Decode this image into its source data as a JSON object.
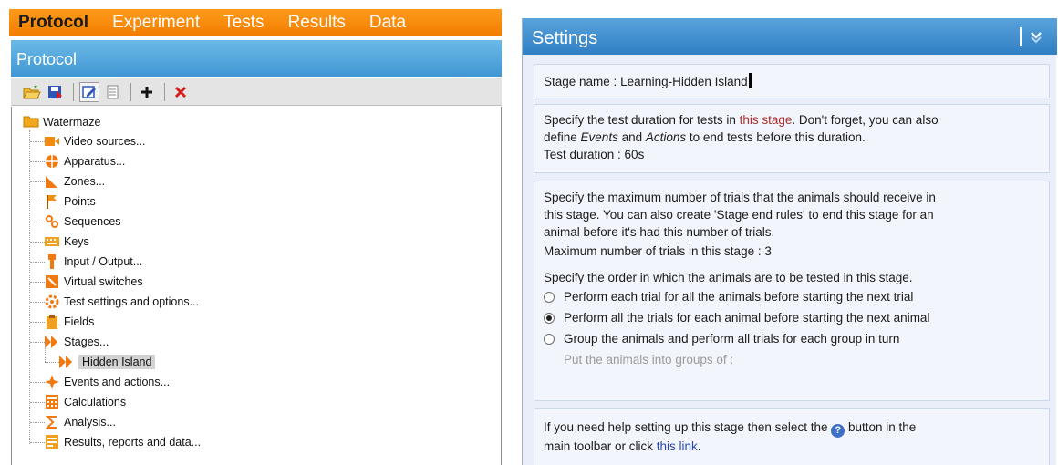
{
  "left_panel": {
    "menu": [
      "Protocol",
      "Experiment",
      "Tests",
      "Results",
      "Data"
    ],
    "section_title": "Protocol",
    "tree": {
      "root": "Watermaze",
      "items": [
        {
          "label": "Video sources...",
          "icon": "video-icon"
        },
        {
          "label": "Apparatus...",
          "icon": "apparatus-icon"
        },
        {
          "label": "Zones...",
          "icon": "zones-icon"
        },
        {
          "label": "Points",
          "icon": "flag-icon"
        },
        {
          "label": "Sequences",
          "icon": "sequences-icon"
        },
        {
          "label": "Keys",
          "icon": "keyboard-icon"
        },
        {
          "label": "Input / Output...",
          "icon": "io-icon"
        },
        {
          "label": "Virtual switches",
          "icon": "switch-icon"
        },
        {
          "label": "Test settings and options...",
          "icon": "gear-icon"
        },
        {
          "label": "Fields",
          "icon": "clipboard-icon"
        },
        {
          "label": "Stages...",
          "icon": "stages-icon"
        },
        {
          "label": "Hidden Island",
          "icon": "stages-icon",
          "child": true,
          "selected": true
        },
        {
          "label": "Events and actions...",
          "icon": "event-icon"
        },
        {
          "label": "Calculations",
          "icon": "calculator-icon"
        },
        {
          "label": "Analysis...",
          "icon": "sigma-icon"
        },
        {
          "label": "Results, reports and data...",
          "icon": "report-icon"
        }
      ]
    }
  },
  "settings": {
    "title": "Settings",
    "stage_name_label": "Stage name  :  ",
    "stage_name_value": "Learning-Hidden Island",
    "duration": {
      "text_a": "Specify the test duration for tests in ",
      "link": "this stage",
      "text_b": ". Don't forget, you can also",
      "text_c": "define ",
      "events": "Events",
      "and": " and ",
      "actions": "Actions",
      "text_d": " to end tests before this duration.",
      "label": "Test duration  :  60s"
    },
    "trials": {
      "line1": "Specify the maximum number of trials that the animals should receive in",
      "line2": "this stage. You can also create 'Stage end rules' to end this stage for an",
      "line3": "animal before it's had this number of trials.",
      "max_label": "Maximum number of trials in this stage  :  3",
      "order_text": "Specify the order in which the animals are to be tested in this stage.",
      "options": [
        "Perform each trial for all the animals before starting the next trial",
        "Perform all the trials for each animal before starting the next animal",
        "Group the animals and perform all trials for each group in turn"
      ],
      "selected_index": 1,
      "groups_label": "Put the animals into groups of :"
    },
    "help": {
      "text_a": "If you need help setting up this stage then select the ",
      "text_b": " button in the",
      "text_c": "main toolbar or click ",
      "link": "this link",
      "text_d": "."
    }
  },
  "colors": {
    "menubar": "#f27d00",
    "header_blue": "#3f97d3",
    "settings_blue": "#2f7fc4",
    "panel_bg": "#e9eef8",
    "link_red": "#b02a2a",
    "link_blue": "#2a47b0"
  }
}
